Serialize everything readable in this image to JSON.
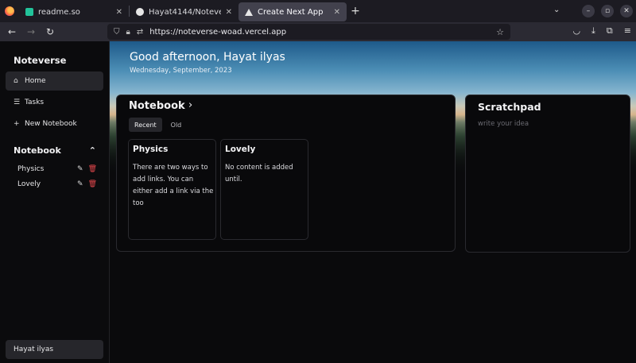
{
  "browser": {
    "tabs": [
      {
        "title": "readme.so",
        "active": false,
        "favicon_color": "#22c39a"
      },
      {
        "title": "Hayat4144/Noteverse: N",
        "active": false,
        "favicon_color": "#e6e6e6"
      },
      {
        "title": "Create Next App",
        "active": true,
        "favicon_color": "#e6e6e6"
      }
    ],
    "url": "https://noteverse-woad.vercel.app"
  },
  "sidebar": {
    "brand": "Noteverse",
    "items": [
      {
        "label": "Home",
        "icon": "home-icon"
      },
      {
        "label": "Tasks",
        "icon": "list-icon"
      },
      {
        "label": "New Notebook",
        "icon": "plus-icon"
      }
    ],
    "notebook_heading": "Notebook",
    "notebooks": [
      {
        "name": "Physics"
      },
      {
        "name": "Lovely"
      }
    ],
    "user": "Hayat ilyas"
  },
  "hero": {
    "greeting": "Good afternoon, Hayat ilyas",
    "date": "Wednesday, September, 2023"
  },
  "notebook_panel": {
    "title": "Notebook",
    "tabs": [
      "Recent",
      "Old"
    ],
    "cards": [
      {
        "title": "Physics",
        "body": "There are two ways to add links. You can either add a link via the too"
      },
      {
        "title": "Lovely",
        "body": "No content is added until."
      }
    ]
  },
  "scratchpad": {
    "title": "Scratchpad",
    "placeholder": "write your idea"
  },
  "colors": {
    "accent_delete": "#e5484d",
    "panel_bg": "#09090b",
    "active_item_bg": "#26262b"
  }
}
